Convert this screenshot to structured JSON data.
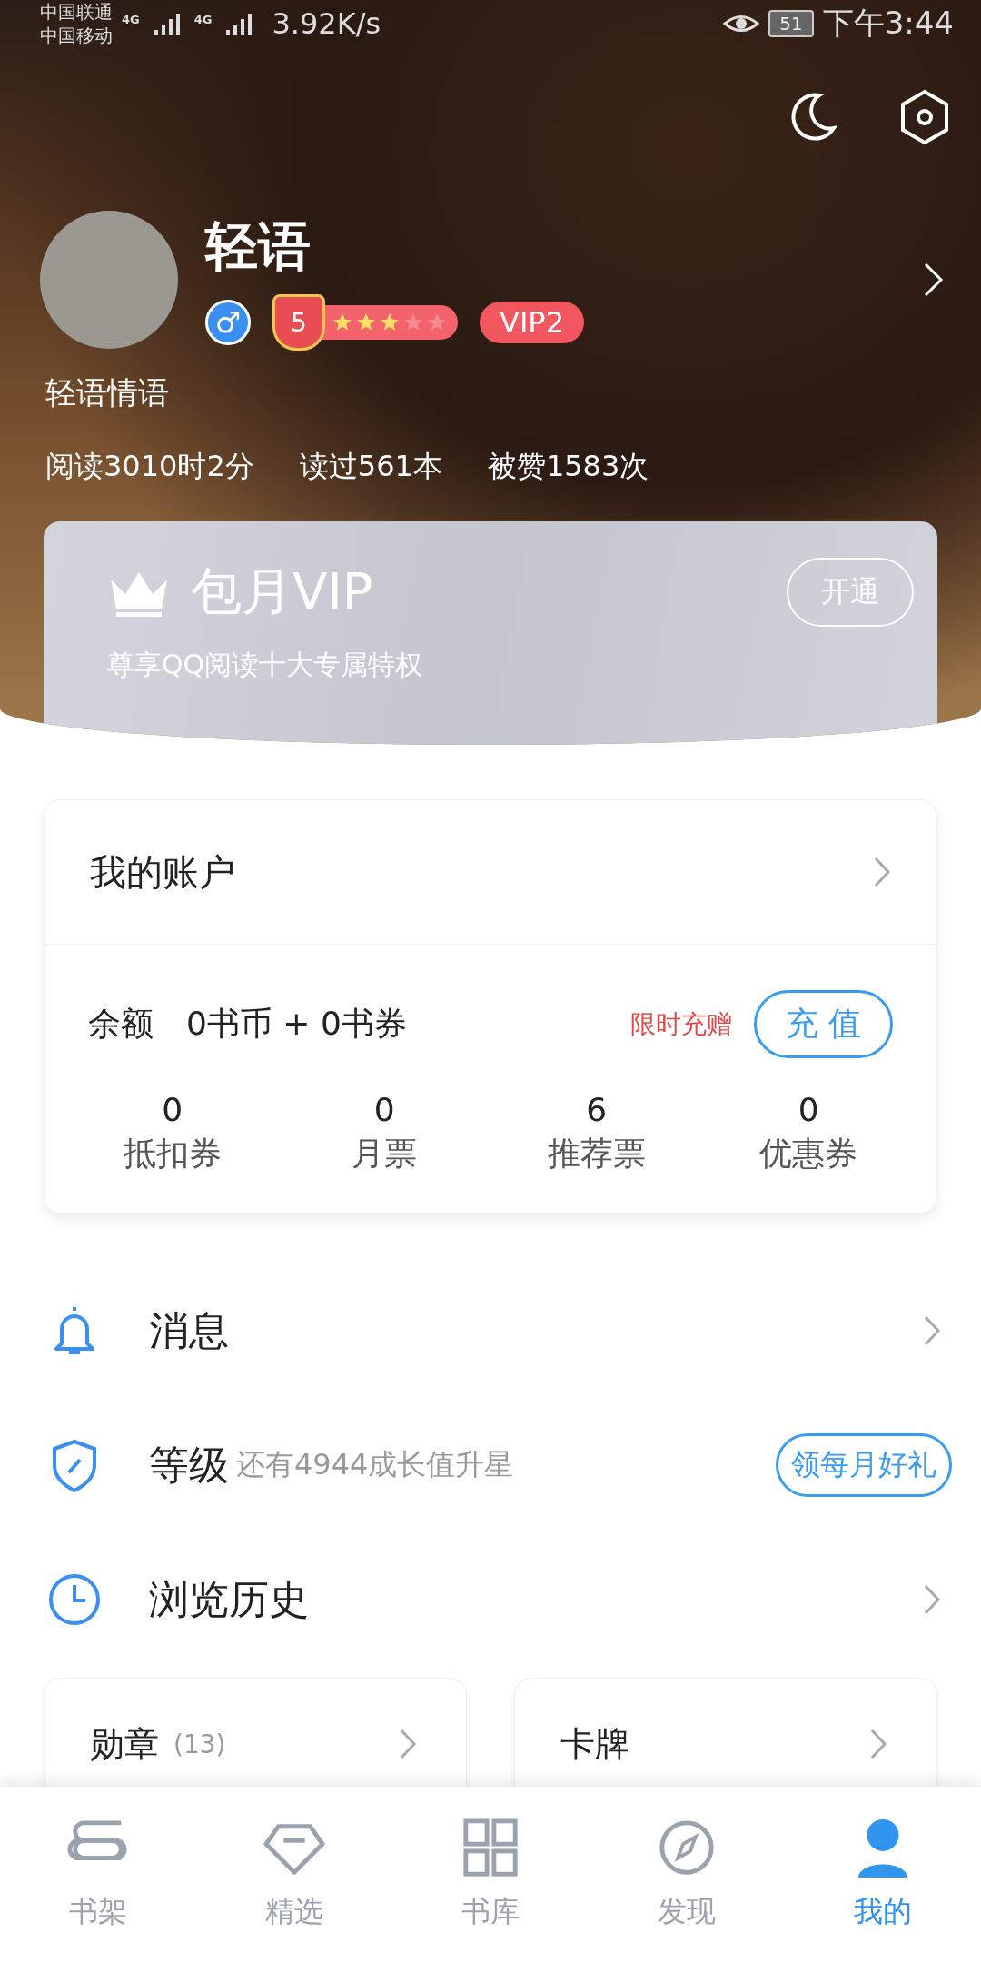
{
  "status_bar": {
    "carrier_1": "中国联通",
    "carrier_2": "中国移动",
    "network_1": "4G",
    "network_2": "4G",
    "speed": "3.92K/s",
    "battery": "51",
    "time": "下午3:44"
  },
  "profile": {
    "name": "轻语",
    "gender_symbol": "♂",
    "level": "5",
    "stars": 3,
    "vip": "VIP2",
    "signature": "轻语情语",
    "stats": [
      "阅读3010时2分",
      "读过561本",
      "被赞1583次"
    ]
  },
  "vip_card": {
    "title": "包月VIP",
    "subtitle": "尊享QQ阅读十大专属特权",
    "button": "开通"
  },
  "account": {
    "title": "我的账户",
    "balance_label": "余额",
    "balance": "0书币 + 0书券",
    "promo": "限时充赠",
    "recharge_button": "充 值",
    "counters": [
      {
        "value": "0",
        "label": "抵扣券"
      },
      {
        "value": "0",
        "label": "月票"
      },
      {
        "value": "6",
        "label": "推荐票"
      },
      {
        "value": "0",
        "label": "优惠券"
      }
    ]
  },
  "menu": [
    {
      "kind": "bell",
      "label": "消息"
    },
    {
      "kind": "shield",
      "label": "等级",
      "hint": "还有4944成长值升星",
      "button": "领每月好礼"
    },
    {
      "kind": "clock",
      "label": "浏览历史"
    }
  ],
  "cards": [
    {
      "label": "勋章",
      "count": "(13)"
    },
    {
      "label": "卡牌"
    }
  ],
  "tab_bar": [
    {
      "kind": "shelf",
      "label": "书架",
      "selected": false
    },
    {
      "kind": "diamond",
      "label": "精选",
      "selected": false
    },
    {
      "kind": "grid",
      "label": "书库",
      "selected": false
    },
    {
      "kind": "compass",
      "label": "发现",
      "selected": false
    },
    {
      "kind": "person",
      "label": "我的",
      "selected": true
    }
  ]
}
